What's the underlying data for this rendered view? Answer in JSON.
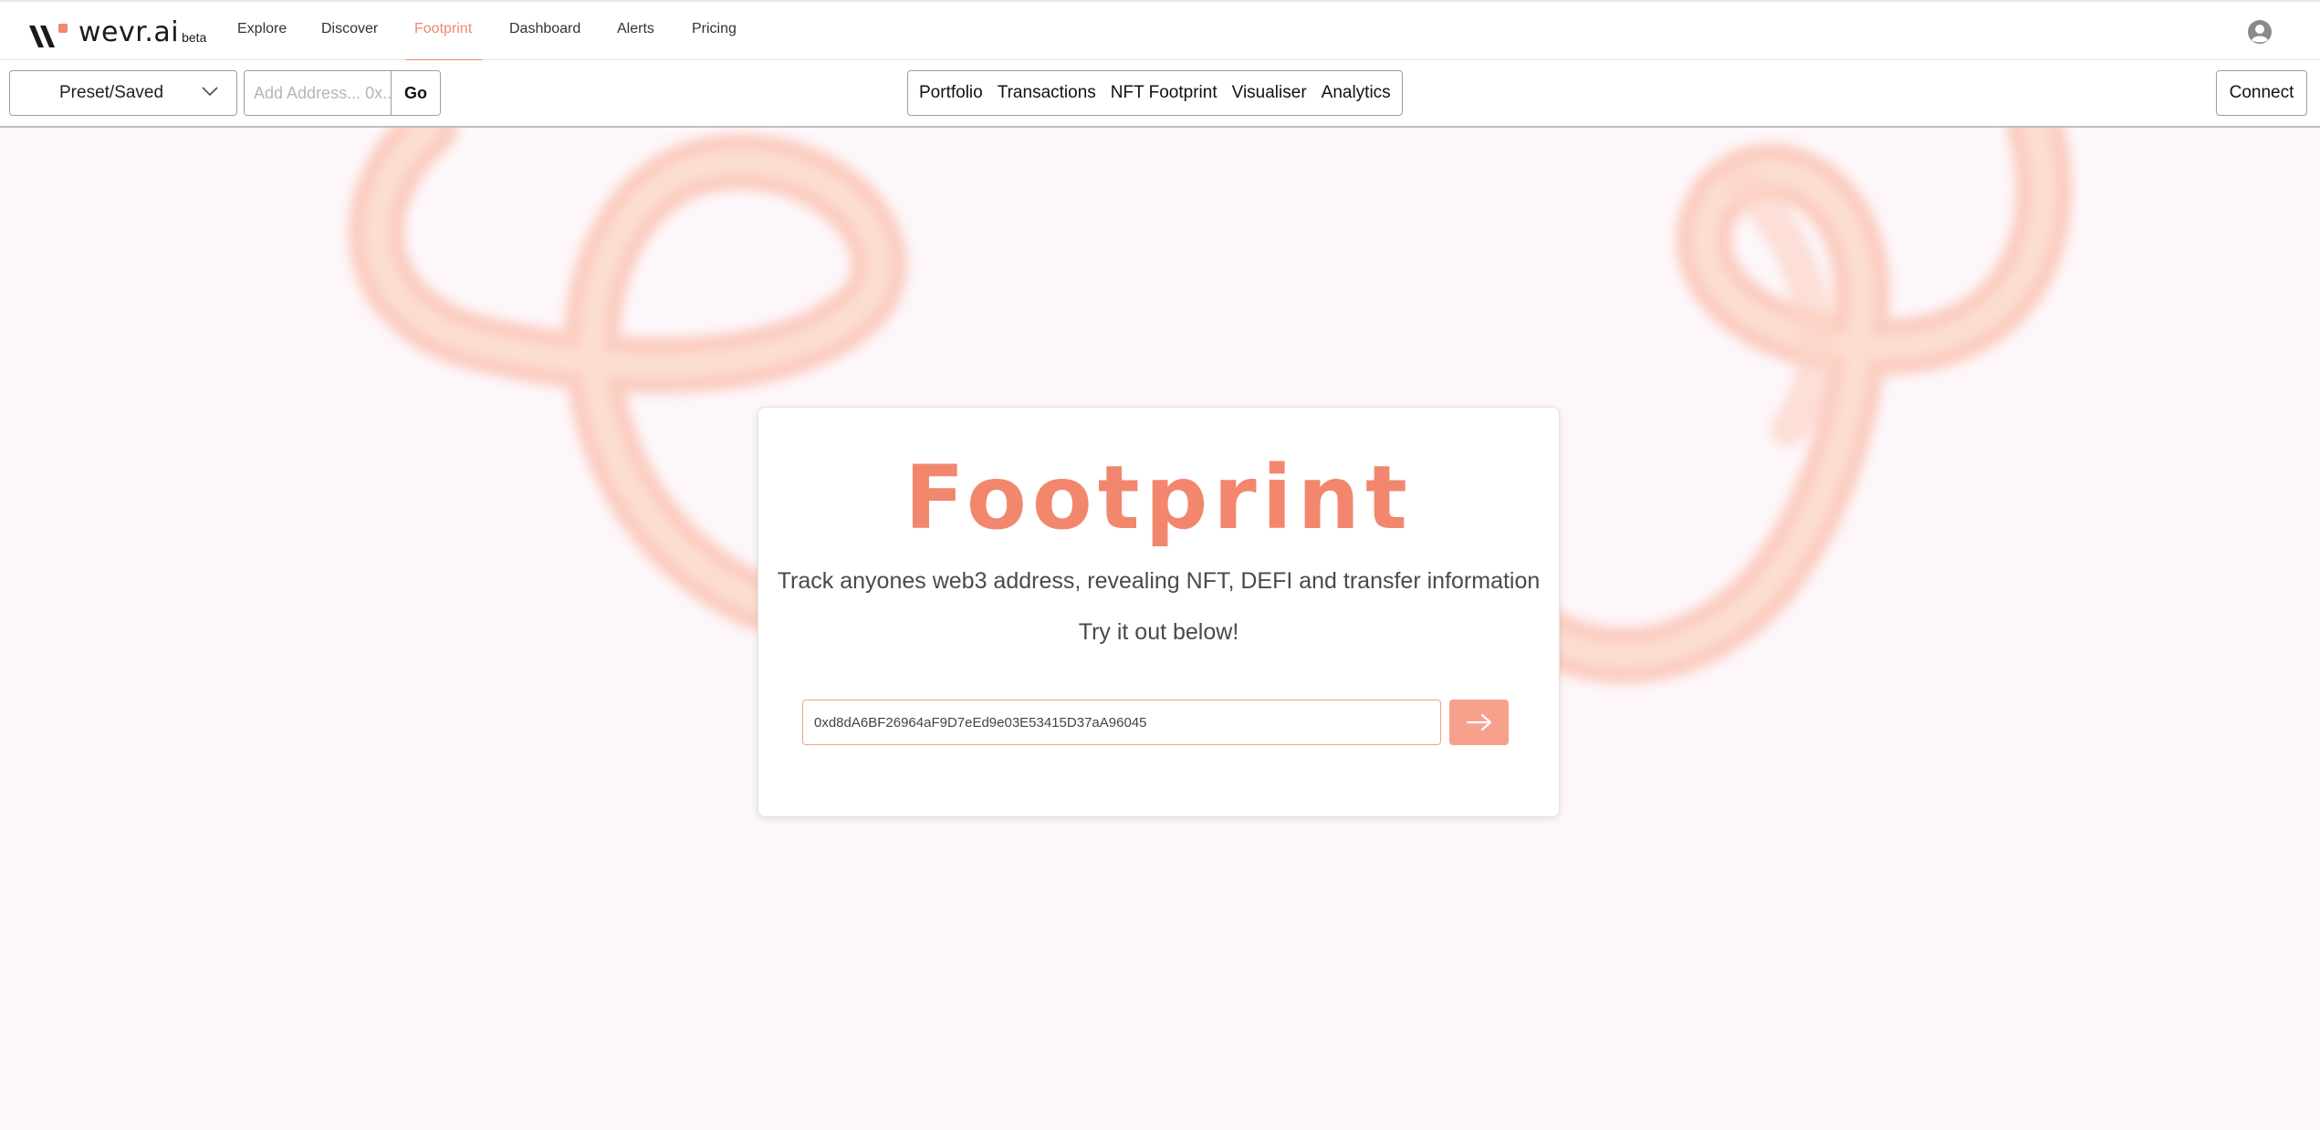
{
  "brand": {
    "name": "wevr.ai",
    "badge": "beta"
  },
  "nav": {
    "items": [
      {
        "label": "Explore"
      },
      {
        "label": "Discover"
      },
      {
        "label": "Footprint",
        "active": true
      },
      {
        "label": "Dashboard"
      },
      {
        "label": "Alerts"
      },
      {
        "label": "Pricing"
      }
    ],
    "avatar_icon": "user-circle-icon"
  },
  "toolbar": {
    "preset_label": "Preset/Saved",
    "address_placeholder": "Add Address... 0x...",
    "go_label": "Go",
    "tabs": [
      {
        "label": "Portfolio"
      },
      {
        "label": "Transactions"
      },
      {
        "label": "NFT Footprint"
      },
      {
        "label": "Visualiser"
      },
      {
        "label": "Analytics"
      }
    ],
    "connect_label": "Connect"
  },
  "hero": {
    "title": "Footprint",
    "subtitle": "Track anyones web3 address, revealing NFT, DEFI and transfer information",
    "cta_text": "Try it out below!",
    "address_value": "0xd8dA6BF26964aF9D7eEd9e03E53415D37aA96045",
    "submit_icon": "arrow-right-icon"
  },
  "colors": {
    "accent": "#f2876e",
    "button": "#f7a18c",
    "background": "#fdf7fa",
    "ribbon": "#fcc9bb"
  }
}
